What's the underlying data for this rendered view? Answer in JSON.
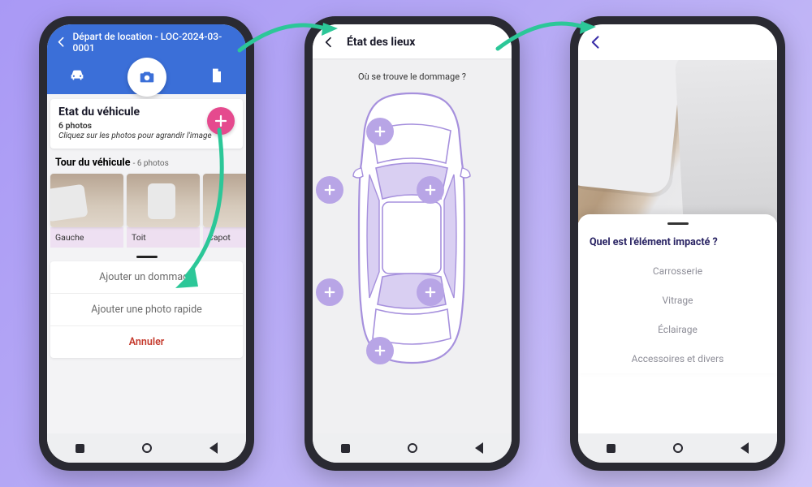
{
  "phone1": {
    "topbar_label": "Départ de location - LOC-2024-03-0001",
    "section_title": "Etat du véhicule",
    "section_count": "6 photos",
    "section_instruction": "Cliquez sur les photos pour agrandir l'image",
    "tour_title": "Tour du véhicule",
    "tour_count": "- 6 photos",
    "thumbs": [
      {
        "label": "Gauche"
      },
      {
        "label": "Toit"
      },
      {
        "label": "Capot"
      }
    ],
    "actions": {
      "add_damage": "Ajouter un dommage",
      "add_photo": "Ajouter une photo rapide",
      "cancel": "Annuler"
    }
  },
  "phone2": {
    "header": "État des lieux",
    "question": "Où se trouve le dommage ?"
  },
  "phone3": {
    "question": "Quel est l'élément impacté ?",
    "options": [
      "Carrosserie",
      "Vitrage",
      "Éclairage",
      "Accessoires et divers"
    ]
  },
  "colors": {
    "primary_blue": "#3b6fd8",
    "accent_pink": "#e54a8e",
    "accent_purple": "#a690dd",
    "accent_teal": "#2cc798",
    "cancel_red": "#c53b2e"
  }
}
